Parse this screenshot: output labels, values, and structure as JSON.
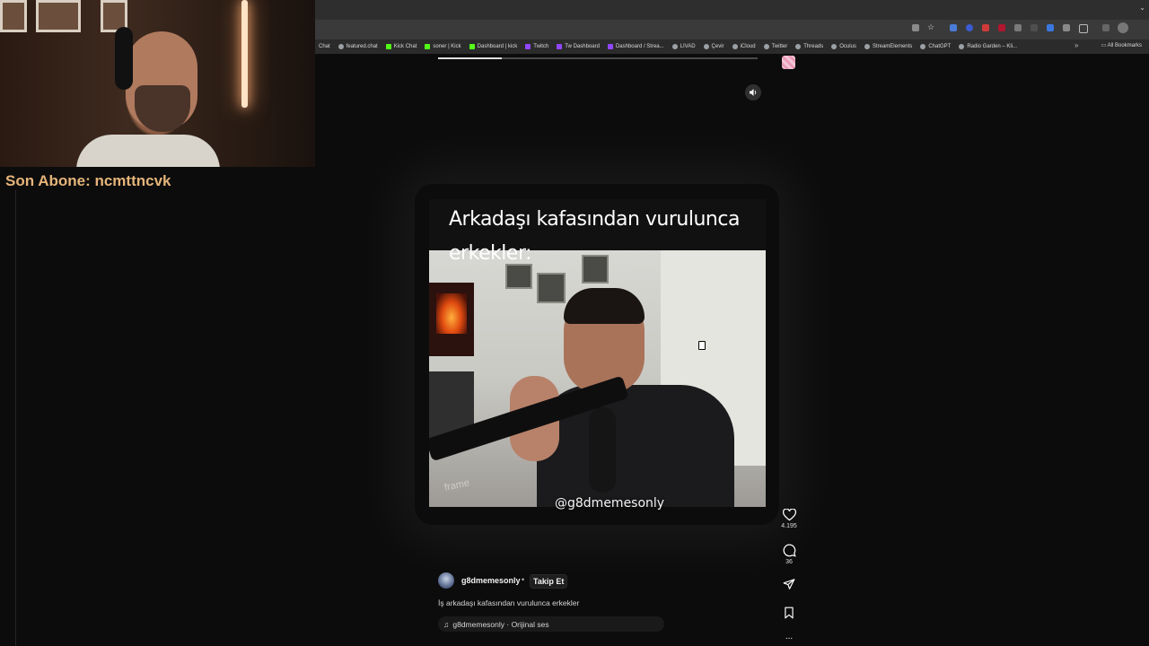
{
  "browser": {
    "bookmarks": [
      {
        "label": "Chat",
        "icon": "generic"
      },
      {
        "label": "featured.chat",
        "icon": "generic"
      },
      {
        "label": "Kick Chat",
        "icon": "kick"
      },
      {
        "label": "soner | Kick",
        "icon": "kick"
      },
      {
        "label": "Dashboard | kick",
        "icon": "kick"
      },
      {
        "label": "Twitch",
        "icon": "twitch"
      },
      {
        "label": "Tw Dashboard",
        "icon": "twitch"
      },
      {
        "label": "Dashboard / Strea...",
        "icon": "twitch"
      },
      {
        "label": "LIVAD",
        "icon": "generic"
      },
      {
        "label": "Çevir",
        "icon": "generic"
      },
      {
        "label": "iCloud",
        "icon": "generic"
      },
      {
        "label": "Twitter",
        "icon": "generic"
      },
      {
        "label": "Threads",
        "icon": "generic"
      },
      {
        "label": "Oculus",
        "icon": "generic"
      },
      {
        "label": "StreamElements",
        "icon": "generic"
      },
      {
        "label": "ChatGPT",
        "icon": "generic"
      },
      {
        "label": "Radio Garden – Kli..."
      }
    ],
    "more_label": "»",
    "all_bookmarks": "All Bookmarks"
  },
  "stream_overlay": {
    "last_sub": "Son Abone: ncmttncvk"
  },
  "reel": {
    "progress": 0.2,
    "caption_overlay": "Arkadaşı kafasından vurulunca erkekler:",
    "watermark": "@g8dmemesonly",
    "frame_mark": "frame",
    "likes": "4.195",
    "comments": "36",
    "username": "g8dmemesonly",
    "separator": "•",
    "follow_label": "Takip Et",
    "description": "İş arkadaşı kafasından vurulunca erkekler",
    "audio": "g8dmemesonly · Orijinal ses",
    "more_label": "...",
    "music_icon": "♫"
  },
  "colors": {
    "overlay_text": "#e5b47a",
    "background": "#0c0c0c"
  }
}
